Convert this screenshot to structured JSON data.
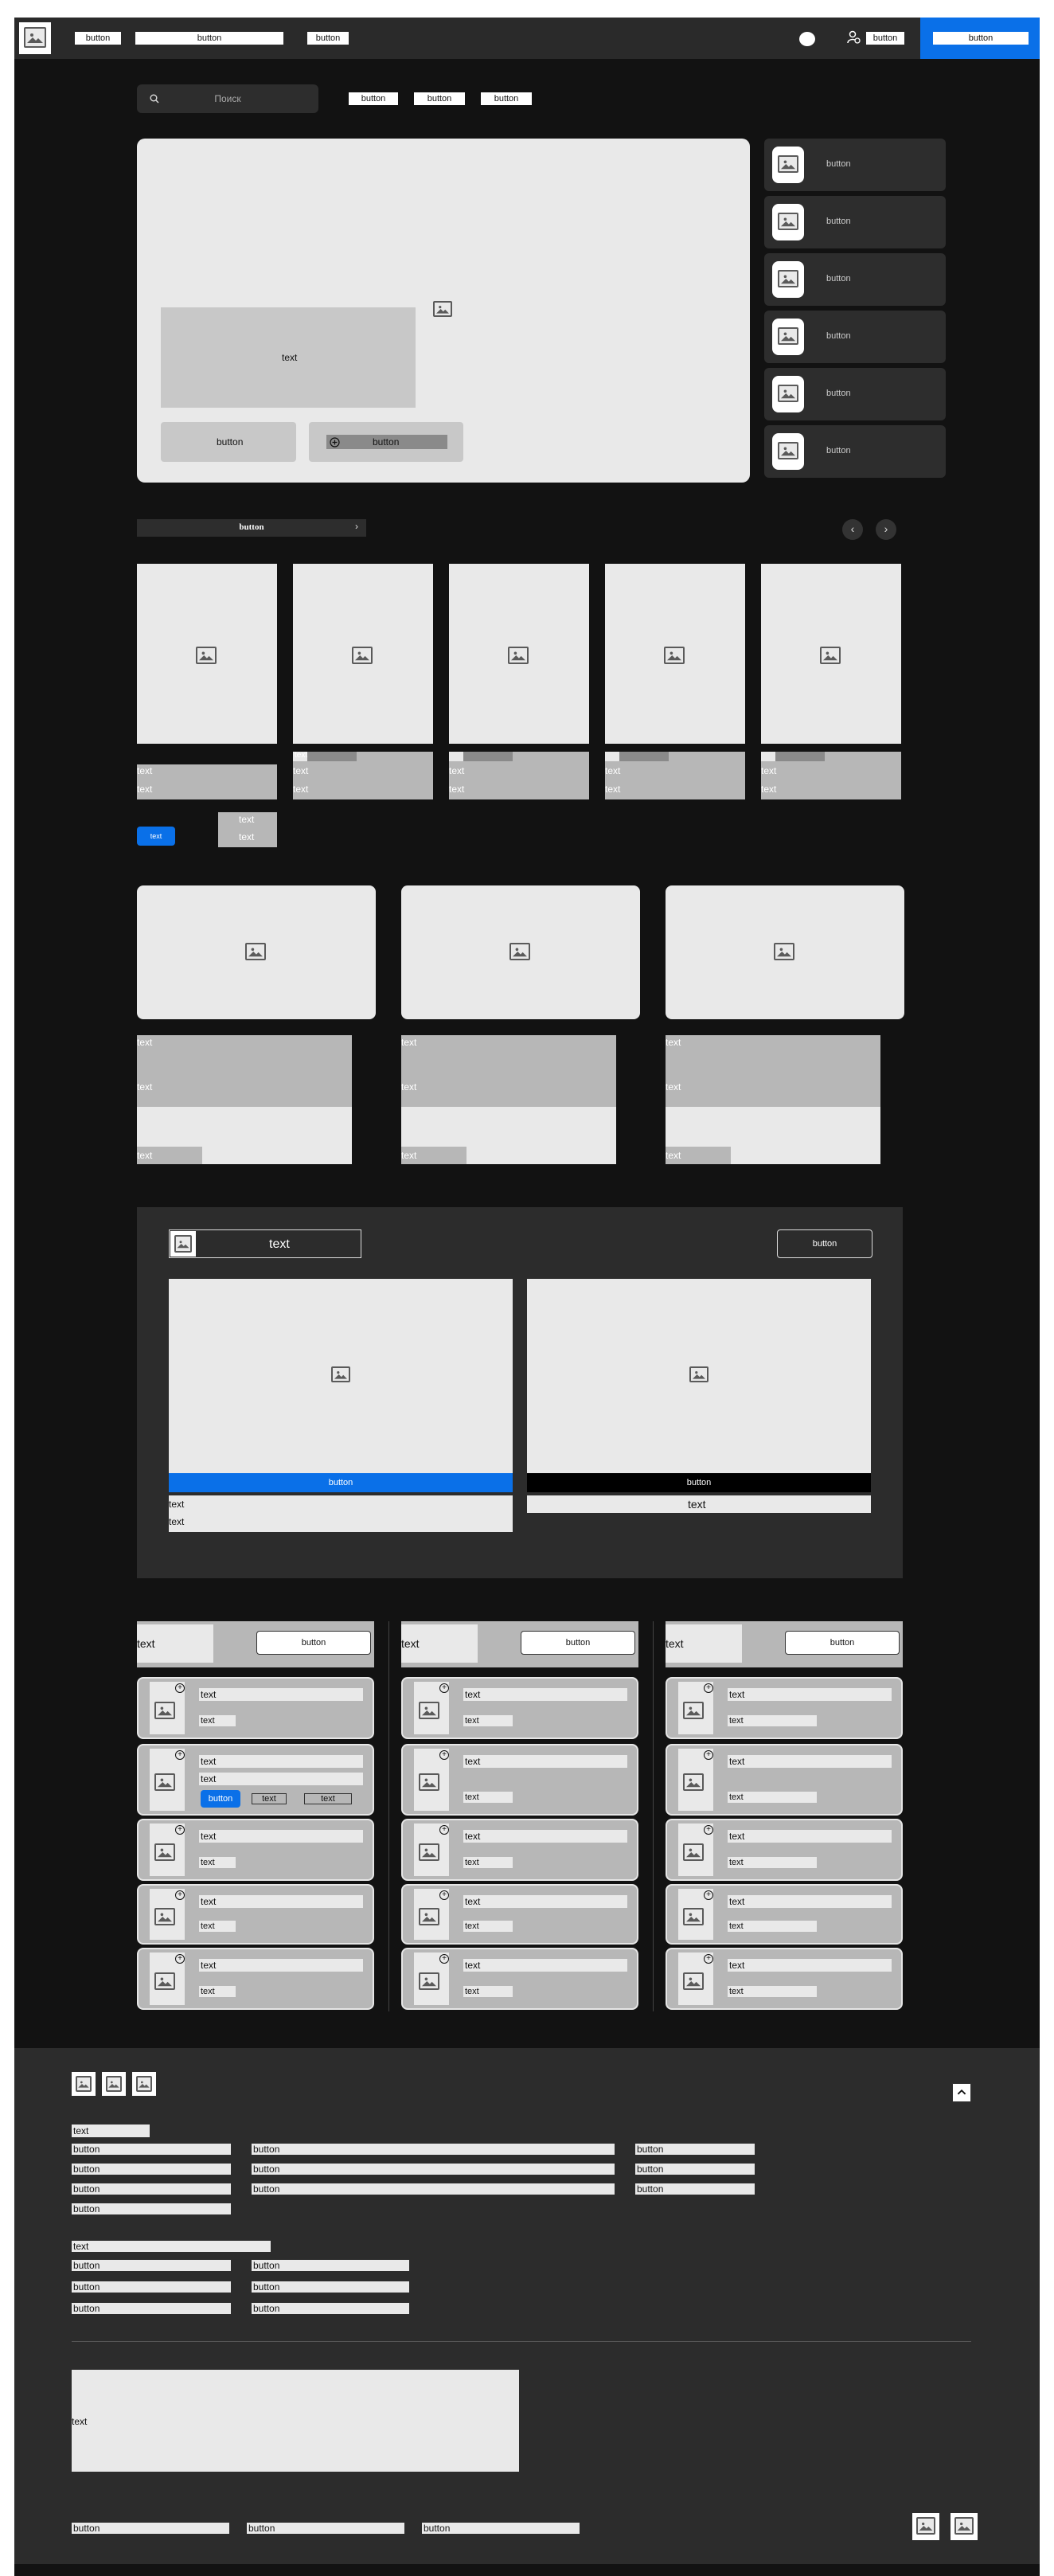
{
  "header": {
    "btn1": "button",
    "btn2": "button",
    "btn3": "button",
    "btn4": "button",
    "cta": "button"
  },
  "search": {
    "placeholder": "Поиск",
    "btn1": "button",
    "btn2": "button",
    "btn3": "button"
  },
  "hero": {
    "text": "text",
    "btn1": "button",
    "btn2": "button"
  },
  "side": [
    "button",
    "button",
    "button",
    "button",
    "button",
    "button"
  ],
  "carousel": {
    "bar_label": "button"
  },
  "cards": [
    {
      "t1": "text",
      "t2": "text"
    },
    {
      "t0": "text",
      "t1": "text",
      "t2": "text"
    },
    {
      "t1": "text",
      "t2": "text"
    },
    {
      "t1": "text",
      "t2": "text"
    },
    {
      "t1": "text",
      "t2": "text"
    }
  ],
  "cards_extra": {
    "badge": "text",
    "t1": "text",
    "t2": "text"
  },
  "features": [
    {
      "t1": "text",
      "t2": "text",
      "t3": "text"
    },
    {
      "t1": "text",
      "t2": "text",
      "t3": "text"
    },
    {
      "t1": "text",
      "t2": "text",
      "t3": "text"
    }
  ],
  "panel": {
    "title": "text",
    "btn": "button",
    "left_btn": "button",
    "left_t1": "text",
    "left_t2": "text",
    "right_btn": "button",
    "right_t": "text"
  },
  "columns": [
    {
      "head": "text",
      "btn": "button",
      "items": [
        {
          "a": "text",
          "b": "text"
        },
        {
          "a": "text",
          "b": "text",
          "c": "button",
          "d": "text",
          "e": "text"
        },
        {
          "a": "text",
          "b": "text"
        },
        {
          "a": "text",
          "b": "text"
        },
        {
          "a": "text",
          "b": "text"
        }
      ]
    },
    {
      "head": "text",
      "btn": "button",
      "items": [
        {
          "a": "text",
          "b": "text"
        },
        {
          "a": "text",
          "b": "text"
        },
        {
          "a": "text",
          "b": "text"
        },
        {
          "a": "text",
          "b": "text"
        },
        {
          "a": "text",
          "b": "text"
        }
      ]
    },
    {
      "head": "text",
      "btn": "button",
      "items": [
        {
          "a": "text",
          "b": "text"
        },
        {
          "a": "text",
          "b": "text"
        },
        {
          "a": "text",
          "b": "text"
        },
        {
          "a": "text",
          "b": "text"
        },
        {
          "a": "text",
          "b": "text"
        }
      ]
    }
  ],
  "footer": {
    "title1": "text",
    "colA": [
      "button",
      "button",
      "button",
      "button"
    ],
    "colB": [
      "button",
      "button",
      "button"
    ],
    "colC": [
      "button",
      "button",
      "button"
    ],
    "title2": "text",
    "colD": [
      "button",
      "button",
      "button"
    ],
    "colE": [
      "button",
      "button",
      "button"
    ],
    "box": "text",
    "bottom": [
      "button",
      "button",
      "button"
    ]
  }
}
